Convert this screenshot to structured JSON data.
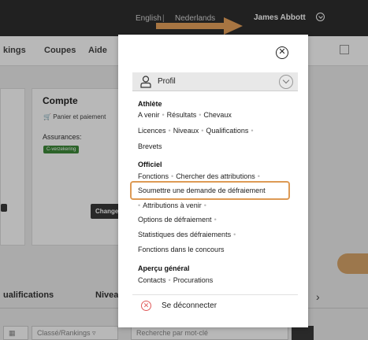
{
  "topbar": {
    "lang_en": "English",
    "lang_sep": "|",
    "lang_nl": "Nederlands",
    "user_name": "James Abbott",
    "arrow_color": "#e8a35c"
  },
  "nav": {
    "items": [
      "kings",
      "Coupes",
      "Aide"
    ]
  },
  "background": {
    "card_title": "Compte",
    "cart_label": "Panier et paiement",
    "assurances_label": "Assurances:",
    "badge_label": "C-verzekering",
    "change_button": "Change",
    "tabs": [
      "ualifications",
      "Nivea"
    ],
    "filter_classe": "Classé/Rankings",
    "search_placeholder": "Recherche par mot-clé"
  },
  "popup": {
    "close_symbol": "✕",
    "profile_label": "Profil",
    "athlete": {
      "title": "Athlète",
      "row1": [
        "A venir",
        "Résultats",
        "Chevaux"
      ],
      "row2": [
        "Licences",
        "Niveaux",
        "Qualifications"
      ],
      "row3": [
        "Brevets"
      ]
    },
    "officiel": {
      "title": "Officiel",
      "row1": [
        "Fonctions",
        "Chercher des attributions"
      ],
      "highlighted": "Soumettre une demande de défraiement",
      "row3": [
        "Attributions à venir"
      ],
      "row4": "Options de défraiement",
      "row5": "Statistiques des défraiements",
      "row6": "Fonctions dans le concours"
    },
    "apercu": {
      "title": "Aperçu général",
      "row1": [
        "Contacts",
        "Procurations"
      ]
    },
    "logout_label": "Se déconnecter",
    "highlight_color": "#dd9a55"
  }
}
